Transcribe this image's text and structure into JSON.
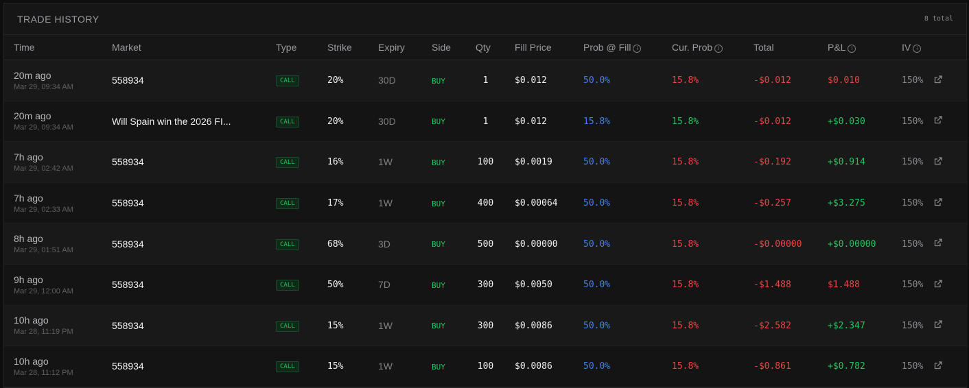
{
  "header": {
    "title": "TRADE HISTORY",
    "total": "8 total"
  },
  "columns": {
    "time": "Time",
    "market": "Market",
    "type": "Type",
    "strike": "Strike",
    "expiry": "Expiry",
    "side": "Side",
    "qty": "Qty",
    "fill_price": "Fill Price",
    "prob_fill": "Prob @ Fill",
    "cur_prob": "Cur. Prob",
    "total": "Total",
    "pnl": "P&L",
    "iv": "IV"
  },
  "info_icon": "info-circle-icon",
  "link_icon": "external-link-icon",
  "colors": {
    "green": "#22c55e",
    "red": "#ef4444",
    "blue": "#3b82f6"
  },
  "rows": [
    {
      "time": "20m ago",
      "date": "Mar 29, 09:34 AM",
      "market": "558934",
      "type": "CALL",
      "strike": "20%",
      "expiry": "30D",
      "side": "BUY",
      "qty": "1",
      "fill": "$0.012",
      "prob_fill": "50.0%",
      "cur_prob": "15.8%",
      "cur_prob_color": "red",
      "total": "-$0.012",
      "pnl": "$0.010",
      "pnl_color": "red",
      "iv": "150%"
    },
    {
      "time": "20m ago",
      "date": "Mar 29, 09:34 AM",
      "market": "Will Spain win the 2026 FI...",
      "type": "CALL",
      "strike": "20%",
      "expiry": "30D",
      "side": "BUY",
      "qty": "1",
      "fill": "$0.012",
      "prob_fill": "15.8%",
      "cur_prob": "15.8%",
      "cur_prob_color": "green",
      "total": "-$0.012",
      "pnl": "+$0.030",
      "pnl_color": "green",
      "iv": "150%"
    },
    {
      "time": "7h ago",
      "date": "Mar 29, 02:42 AM",
      "market": "558934",
      "type": "CALL",
      "strike": "16%",
      "expiry": "1W",
      "side": "BUY",
      "qty": "100",
      "fill": "$0.0019",
      "prob_fill": "50.0%",
      "cur_prob": "15.8%",
      "cur_prob_color": "red",
      "total": "-$0.192",
      "pnl": "+$0.914",
      "pnl_color": "green",
      "iv": "150%"
    },
    {
      "time": "7h ago",
      "date": "Mar 29, 02:33 AM",
      "market": "558934",
      "type": "CALL",
      "strike": "17%",
      "expiry": "1W",
      "side": "BUY",
      "qty": "400",
      "fill": "$0.00064",
      "prob_fill": "50.0%",
      "cur_prob": "15.8%",
      "cur_prob_color": "red",
      "total": "-$0.257",
      "pnl": "+$3.275",
      "pnl_color": "green",
      "iv": "150%"
    },
    {
      "time": "8h ago",
      "date": "Mar 29, 01:51 AM",
      "market": "558934",
      "type": "CALL",
      "strike": "68%",
      "expiry": "3D",
      "side": "BUY",
      "qty": "500",
      "fill": "$0.00000",
      "prob_fill": "50.0%",
      "cur_prob": "15.8%",
      "cur_prob_color": "red",
      "total": "-$0.00000",
      "pnl": "+$0.00000",
      "pnl_color": "green",
      "iv": "150%"
    },
    {
      "time": "9h ago",
      "date": "Mar 29, 12:00 AM",
      "market": "558934",
      "type": "CALL",
      "strike": "50%",
      "expiry": "7D",
      "side": "BUY",
      "qty": "300",
      "fill": "$0.0050",
      "prob_fill": "50.0%",
      "cur_prob": "15.8%",
      "cur_prob_color": "red",
      "total": "-$1.488",
      "pnl": "$1.488",
      "pnl_color": "red",
      "iv": "150%"
    },
    {
      "time": "10h ago",
      "date": "Mar 28, 11:19 PM",
      "market": "558934",
      "type": "CALL",
      "strike": "15%",
      "expiry": "1W",
      "side": "BUY",
      "qty": "300",
      "fill": "$0.0086",
      "prob_fill": "50.0%",
      "cur_prob": "15.8%",
      "cur_prob_color": "red",
      "total": "-$2.582",
      "pnl": "+$2.347",
      "pnl_color": "green",
      "iv": "150%"
    },
    {
      "time": "10h ago",
      "date": "Mar 28, 11:12 PM",
      "market": "558934",
      "type": "CALL",
      "strike": "15%",
      "expiry": "1W",
      "side": "BUY",
      "qty": "100",
      "fill": "$0.0086",
      "prob_fill": "50.0%",
      "cur_prob": "15.8%",
      "cur_prob_color": "red",
      "total": "-$0.861",
      "pnl": "+$0.782",
      "pnl_color": "green",
      "iv": "150%"
    }
  ]
}
